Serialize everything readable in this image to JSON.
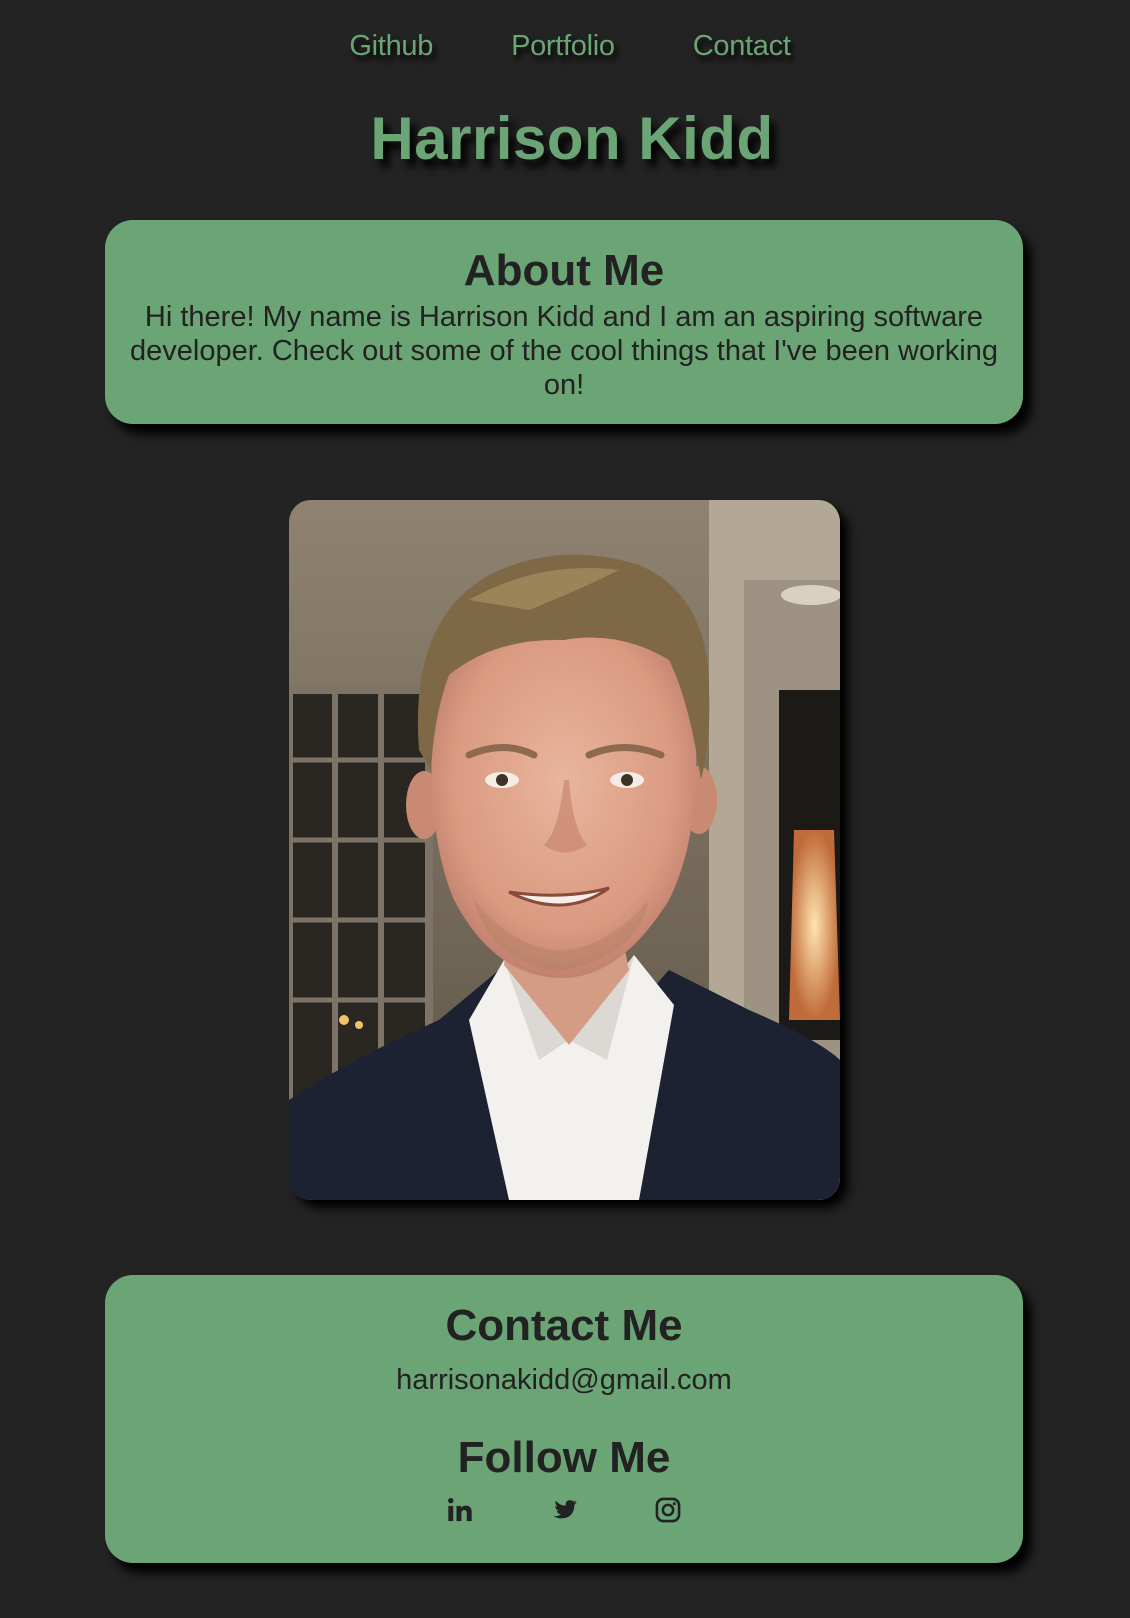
{
  "nav": {
    "items": [
      {
        "label": "Github"
      },
      {
        "label": "Portfolio"
      },
      {
        "label": "Contact"
      }
    ]
  },
  "header": {
    "title": "Harrison Kidd"
  },
  "about": {
    "heading": "About Me",
    "body": "Hi there! My name is Harrison Kidd and I am an aspiring software developer. Check out some of the cool things that I've been working on!"
  },
  "profile_photo": {
    "alt": "Harrison Kidd"
  },
  "contact": {
    "heading": "Contact Me",
    "email": "harrisonakidd@gmail.com",
    "follow_heading": "Follow Me",
    "socials": [
      {
        "icon": "linkedin-icon"
      },
      {
        "icon": "twitter-icon"
      },
      {
        "icon": "instagram-icon"
      }
    ]
  },
  "colors": {
    "background": "#232323",
    "accent": "#6ba475",
    "text_dark": "#222222"
  }
}
